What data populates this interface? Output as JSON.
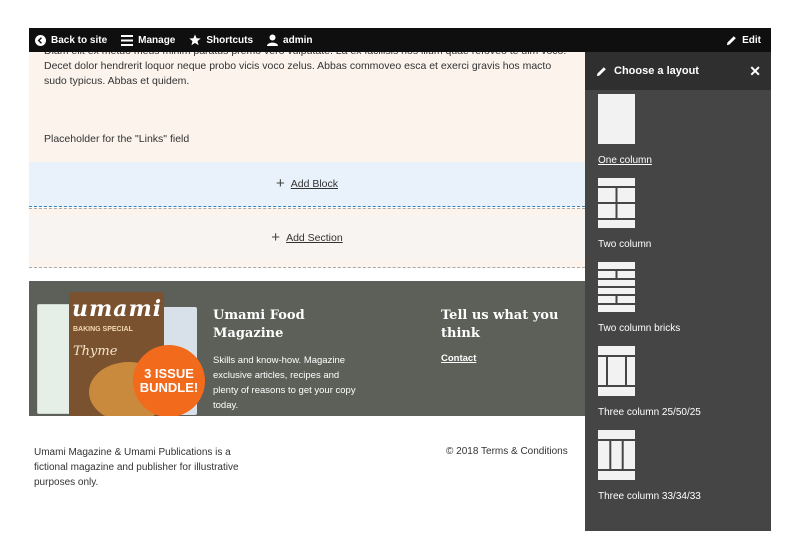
{
  "toolbar": {
    "back_to_site": "Back to site",
    "manage": "Manage",
    "shortcuts": "Shortcuts",
    "admin": "admin",
    "edit": "Edit"
  },
  "content": {
    "body_text": "Diam elit ex metuo meus minim paratus premo vero vulputate. La ex facilisis hos illum quae refoveo te ulm voco. Decet dolor hendrerit loquor neque probo vicis voco zelus. Abbas commoveo esca et exerci gravis hos macto sudo typicus. Abbas et quidem.",
    "placeholder": "Placeholder for the \"Links\" field",
    "add_block": "Add Block",
    "add_section": "Add Section"
  },
  "footer": {
    "magazine_title": "Umami Food Magazine",
    "magazine_desc": "Skills and know-how. Magazine exclusive articles, recipes and plenty of reasons to get your copy today.",
    "cover_masthead": "umami",
    "cover_sub1": "BAKING SPECIAL",
    "cover_sub2": "Thyme",
    "badge_line1": "3 ISSUE",
    "badge_line2": "BUNDLE!",
    "tell_us_title": "Tell us what you think",
    "contact": "Contact",
    "disclaimer": "Umami Magazine & Umami Publications is a fictional magazine and publisher for illustrative purposes only.",
    "copyright": "© 2018",
    "terms": "Terms & Conditions"
  },
  "sidebar": {
    "title": "Choose a layout",
    "close_icon": "close-icon",
    "layouts": [
      {
        "label": "One column",
        "icon": "one-column-icon",
        "active": true
      },
      {
        "label": "Two column",
        "icon": "two-column-icon",
        "active": false
      },
      {
        "label": "Two column bricks",
        "icon": "two-column-bricks-icon",
        "active": false
      },
      {
        "label": "Three column 25/50/25",
        "icon": "three-column-25-50-25-icon",
        "active": false
      },
      {
        "label": "Three column 33/34/33",
        "icon": "three-column-33-34-33-icon",
        "active": false
      }
    ]
  },
  "colors": {
    "toolbar_bg": "#0f0f0f",
    "sidebar_bg": "#454545",
    "sidebar_header_bg": "#2f2f2f",
    "add_block_bg": "#e9f2fa",
    "content_bg": "#fbf3ec",
    "footer_band_bg": "#5c6058",
    "badge": "#f26a1b",
    "block_border": "#3b82b8"
  }
}
